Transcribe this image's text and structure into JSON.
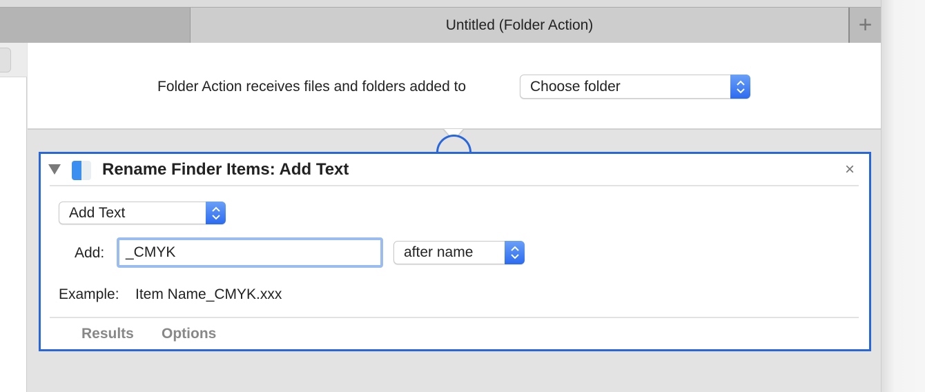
{
  "window": {
    "tab_title": "Untitled (Folder Action)",
    "new_tab": "+"
  },
  "header": {
    "receives_label": "Folder Action receives files and folders added to",
    "folder_popup": "Choose folder"
  },
  "action": {
    "title": "Rename Finder Items: Add Text",
    "close": "×",
    "mode_popup": "Add Text",
    "add_label": "Add:",
    "add_value": "_CMYK",
    "position_popup": "after name",
    "example_label": "Example:",
    "example_value": "Item Name_CMYK.xxx",
    "tabs": [
      "Results",
      "Options"
    ]
  },
  "colors": {
    "accent": "#2866db"
  }
}
